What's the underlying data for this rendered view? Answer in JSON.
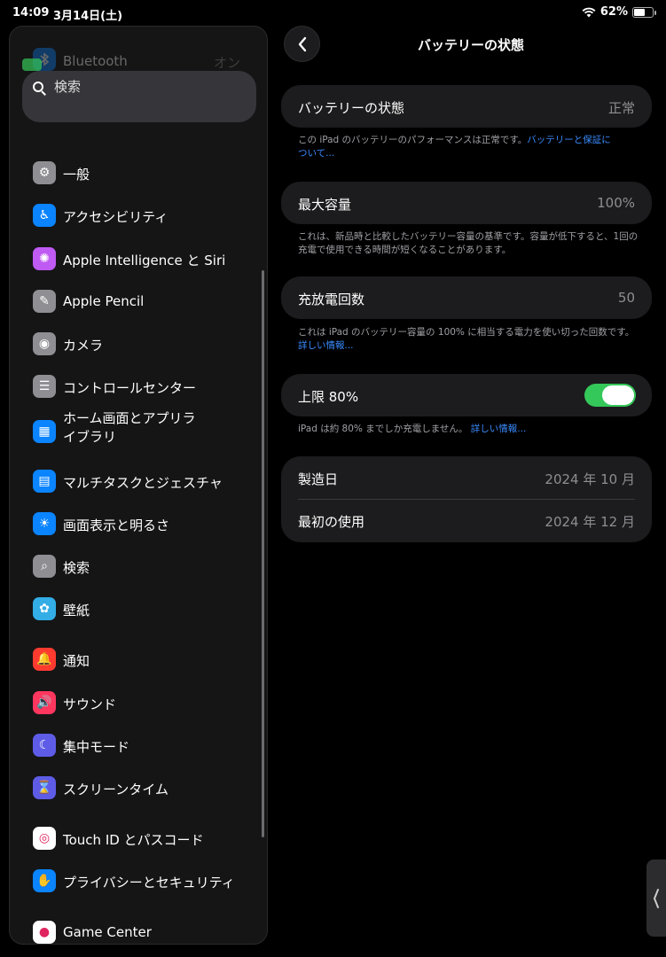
{
  "status": {
    "time": "14:09",
    "date": "3月14日(土)",
    "battery": "62%",
    "battery_level": 0.62
  },
  "sidebar": {
    "faded_label": "Bluetooth",
    "faded_value": "オン",
    "search_placeholder": "検索",
    "items": [
      {
        "label": "一般",
        "icon": "gear-icon",
        "color": "#8e8e93"
      },
      {
        "label": "アクセシビリティ",
        "icon": "accessibility-icon",
        "color": "#0a84ff"
      },
      {
        "label": "Apple Intelligence と Siri",
        "icon": "apple-intelligence-icon",
        "color": "#bf5af2"
      },
      {
        "label": "Apple Pencil",
        "icon": "pencil-icon",
        "color": "#8e8e93"
      },
      {
        "label": "カメラ",
        "icon": "camera-icon",
        "color": "#8e8e93"
      },
      {
        "label": "コントロールセンター",
        "icon": "control-center-icon",
        "color": "#8e8e93"
      },
      {
        "label": "ホーム画面とアプリライブラリ",
        "icon": "home-screen-icon",
        "color": "#0a84ff"
      },
      {
        "label": "マルチタスクとジェスチャ",
        "icon": "multitasking-icon",
        "color": "#0a84ff"
      },
      {
        "label": "画面表示と明るさ",
        "icon": "brightness-icon",
        "color": "#0a84ff"
      },
      {
        "label": "検索",
        "icon": "search-icon",
        "color": "#8e8e93"
      },
      {
        "label": "壁紙",
        "icon": "wallpaper-icon",
        "color": "#32ade6"
      },
      {
        "label": "通知",
        "icon": "notification-bell-icon",
        "color": "#ff3b30"
      },
      {
        "label": "サウンド",
        "icon": "speaker-icon",
        "color": "#ff375f"
      },
      {
        "label": "集中モード",
        "icon": "moon-icon",
        "color": "#5e5ce6"
      },
      {
        "label": "スクリーンタイム",
        "icon": "hourglass-icon",
        "color": "#5e5ce6"
      },
      {
        "label": "Touch ID とパスコード",
        "icon": "fingerprint-icon",
        "color": "#ffffff"
      },
      {
        "label": "プライバシーとセキュリティ",
        "icon": "hand-icon",
        "color": "#0a84ff"
      },
      {
        "label": "Game Center",
        "icon": "game-center-icon",
        "color": "#ffffff"
      }
    ]
  },
  "main": {
    "title": "バッテリーの状態",
    "health": {
      "label": "バッテリーの状態",
      "value": "正常"
    },
    "health_note": "この iPad のバッテリーのパフォーマンスは正常です。",
    "health_link": "バッテリーと保証について...",
    "capacity": {
      "label": "最大容量",
      "value": "100%"
    },
    "capacity_note": "これは、新品時と比較したバッテリー容量の基準です。容量が低下すると、1回の充電で使用できる時間が短くなることがあります。",
    "cycles": {
      "label": "充放電回数",
      "value": "50"
    },
    "cycles_note": "これは iPad のバッテリー容量の 100% に相当する電力を使い切った回数です。",
    "cycles_link": "詳しい情報...",
    "limit": {
      "label": "上限 80%",
      "on": true
    },
    "limit_note": "iPad は約 80% までしか充電しません。",
    "limit_link": "詳しい情報...",
    "manufacture": {
      "label": "製造日",
      "value": "2024 年 10 月"
    },
    "first_use": {
      "label": "最初の使用",
      "value": "2024 年 12 月"
    }
  }
}
